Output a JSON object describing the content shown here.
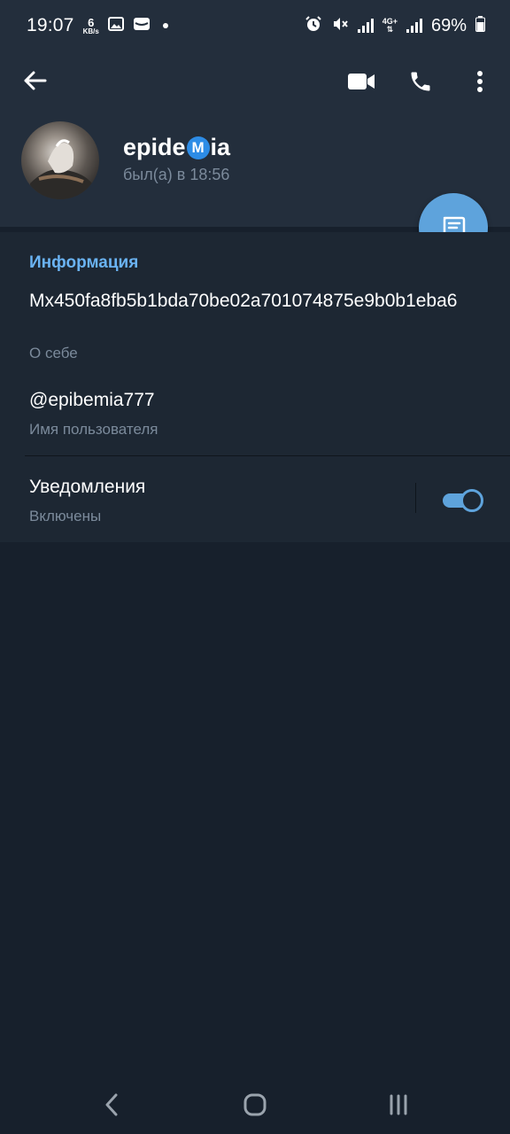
{
  "status_bar": {
    "time": "19:07",
    "net_speed_value": "6",
    "net_speed_unit": "KB/s",
    "network_type": "4G+",
    "battery": "69%"
  },
  "header": {
    "actions": [
      "video-call-icon",
      "phone-icon",
      "more-vert-icon"
    ]
  },
  "profile": {
    "name_prefix": "epide",
    "name_emoji_letter": "M",
    "name_suffix": "ia",
    "last_seen": "был(а) в 18:56"
  },
  "info": {
    "section_title": "Информация",
    "bio_value": "Mx450fa8fb5b1bda70be02a701074875e9b0b1eba6",
    "bio_label": "О себе",
    "username_value": "@epibemia777",
    "username_label": "Имя пользователя",
    "notifications_title": "Уведомления",
    "notifications_status": "Включены",
    "notifications_enabled": true
  },
  "colors": {
    "accent": "#5ea3dc",
    "section_title": "#6ab3f3",
    "header_bg": "#232e3c",
    "section_bg": "#1d2733",
    "page_bg": "#17202c"
  }
}
